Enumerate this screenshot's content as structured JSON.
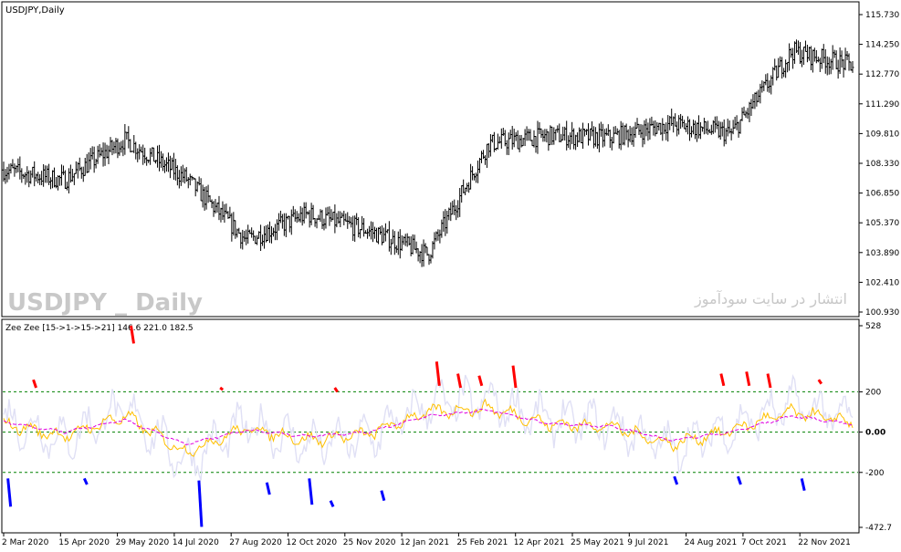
{
  "window": {
    "symbol_label": "USDJPY,Daily",
    "watermark_symbol": "USDJPY _ Daily",
    "watermark_site": "انتشار در سایت سودآموز"
  },
  "colors": {
    "background": "#ffffff",
    "frame": "#000000",
    "bars": "#000000",
    "osc_main": "#e0e0f5",
    "osc_fast": "#ffc000",
    "osc_slow": "#e000e0",
    "overbought_marks": "#ff0000",
    "oversold_marks": "#0000ff",
    "level_lines": "#008000"
  },
  "indicator": {
    "label": "Zee Zee [15->1->15->21] 146.6 221.0 182.5",
    "levels": [
      200,
      0,
      -200
    ]
  },
  "x_axis": {
    "labels": [
      "2 Mar 2020",
      "15 Apr 2020",
      "29 May 2020",
      "14 Jul 2020",
      "27 Aug 2020",
      "12 Oct 2020",
      "25 Nov 2020",
      "12 Jan 2021",
      "25 Feb 2021",
      "12 Apr 2021",
      "25 May 2021",
      "9 Jul 2021",
      "24 Aug 2021",
      "7 Oct 2021",
      "22 Nov 2021"
    ]
  },
  "chart_data": [
    {
      "type": "line",
      "name": "price",
      "y_ticks": [
        "115.730",
        "114.250",
        "112.770",
        "111.290",
        "109.810",
        "108.330",
        "106.850",
        "105.370",
        "103.890",
        "102.410",
        "100.930"
      ],
      "ylim": [
        100.93,
        115.73
      ],
      "x": [
        "2 Mar 2020",
        "15 Apr 2020",
        "29 May 2020",
        "14 Jul 2020",
        "27 Aug 2020",
        "12 Oct 2020",
        "25 Nov 2020",
        "12 Jan 2021",
        "25 Feb 2021",
        "12 Apr 2021",
        "25 May 2021",
        "9 Jul 2021",
        "24 Aug 2021",
        "7 Oct 2021",
        "22 Nov 2021"
      ],
      "series": [
        {
          "values": [
            108.0,
            107.5,
            109.5,
            107.6,
            104.5,
            105.8,
            105.0,
            103.8,
            109.3,
            109.7,
            109.6,
            110.3,
            109.8,
            113.9,
            113.2
          ]
        }
      ]
    },
    {
      "type": "line",
      "name": "oscillator",
      "y_ticks": [
        "528",
        "200",
        "0.00",
        "-200",
        "-472.7"
      ],
      "ylim": [
        -472.7,
        528
      ],
      "x": [
        "2 Mar 2020",
        "15 Apr 2020",
        "29 May 2020",
        "14 Jul 2020",
        "27 Aug 2020",
        "12 Oct 2020",
        "25 Nov 2020",
        "12 Jan 2021",
        "25 Feb 2021",
        "12 Apr 2021",
        "25 May 2021",
        "9 Jul 2021",
        "24 Aug 2021",
        "7 Oct 2021",
        "22 Nov 2021"
      ],
      "series": [
        {
          "values": [
            60,
            -40,
            120,
            -150,
            40,
            -60,
            -30,
            140,
            150,
            60,
            40,
            -80,
            20,
            140,
            60
          ]
        },
        {
          "values": [
            40,
            -20,
            80,
            -100,
            20,
            -40,
            -10,
            100,
            120,
            40,
            30,
            -60,
            10,
            100,
            50
          ]
        },
        {
          "values": [
            50,
            0,
            60,
            -60,
            10,
            -20,
            0,
            80,
            110,
            40,
            30,
            -40,
            0,
            80,
            40
          ]
        }
      ]
    }
  ]
}
